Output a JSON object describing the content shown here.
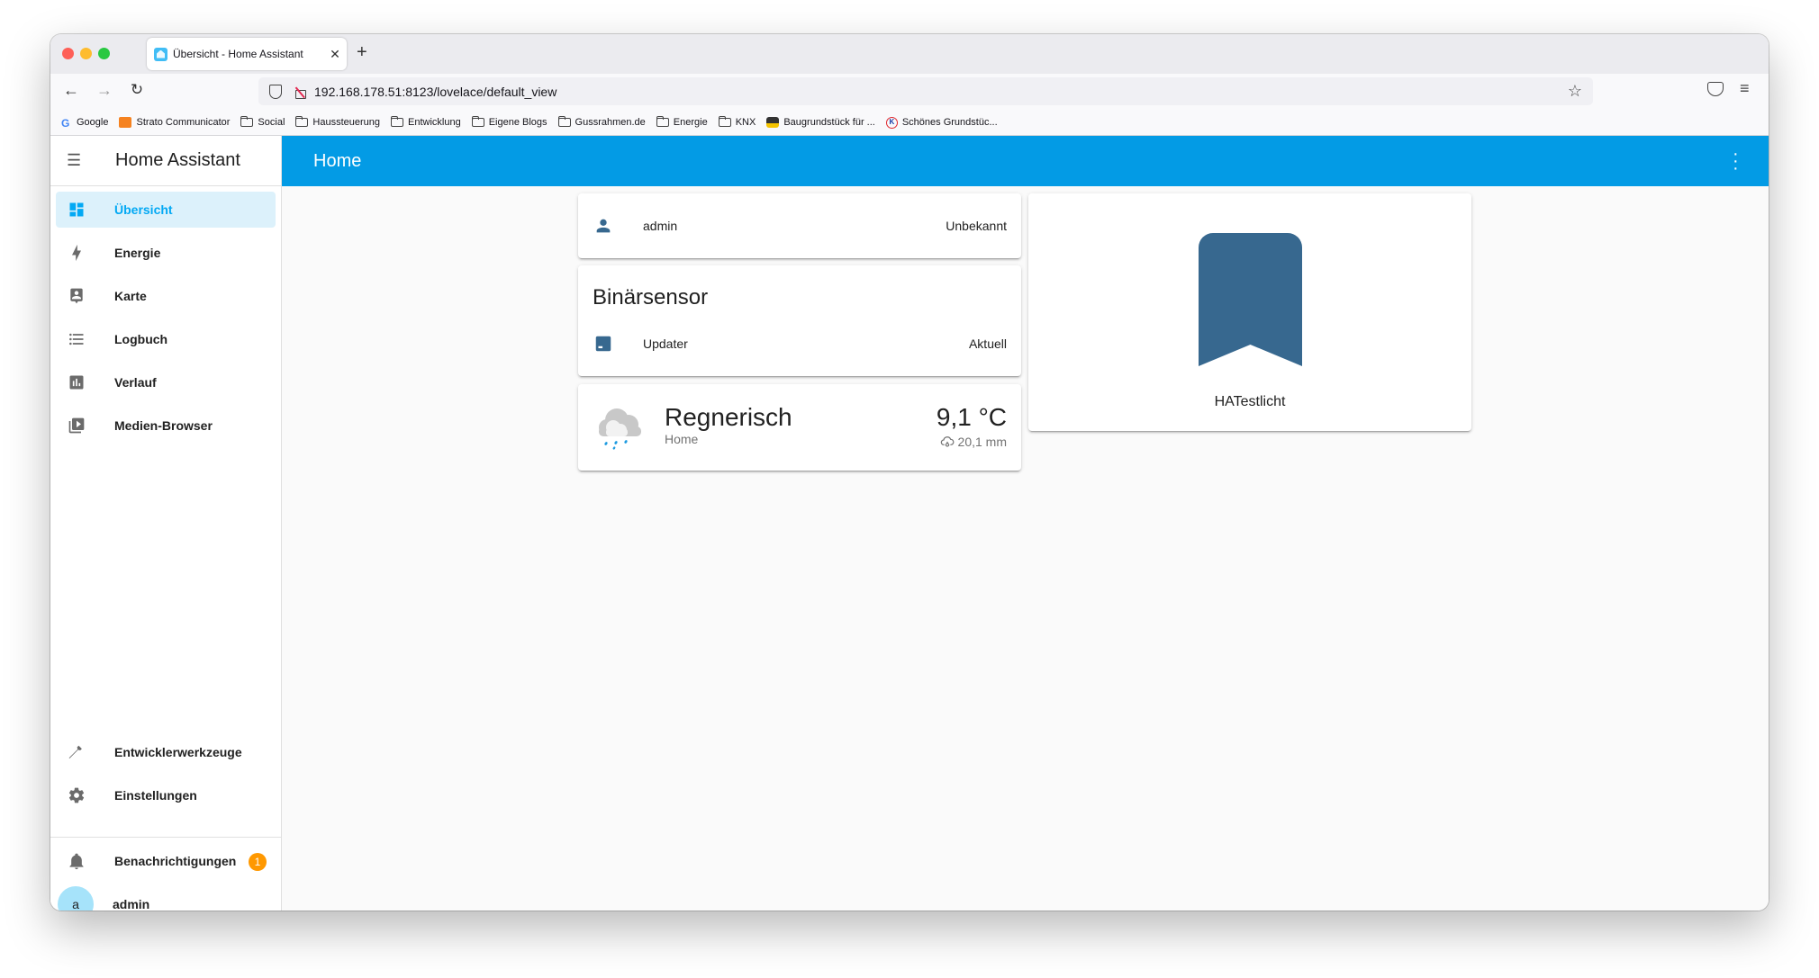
{
  "browser": {
    "tab_title": "Übersicht - Home Assistant",
    "new_tab_label": "+",
    "url": "192.168.178.51:8123/lovelace/default_view",
    "bookmarks": [
      {
        "label": "Google",
        "icon": "google-icon"
      },
      {
        "label": "Strato Communicator",
        "icon": "mail-icon"
      },
      {
        "label": "Social",
        "icon": "folder-icon"
      },
      {
        "label": "Haussteuerung",
        "icon": "folder-icon"
      },
      {
        "label": "Entwicklung",
        "icon": "folder-icon"
      },
      {
        "label": "Eigene Blogs",
        "icon": "folder-icon"
      },
      {
        "label": "Gussrahmen.de",
        "icon": "folder-icon"
      },
      {
        "label": "Energie",
        "icon": "folder-icon"
      },
      {
        "label": "KNX",
        "icon": "folder-icon"
      },
      {
        "label": "Baugrundstück für ...",
        "icon": "immowelt-icon"
      },
      {
        "label": "Schönes Grundstüc...",
        "icon": "k-icon"
      }
    ]
  },
  "sidebar": {
    "title": "Home Assistant",
    "items": [
      {
        "label": "Übersicht",
        "icon": "dashboard-icon",
        "active": true
      },
      {
        "label": "Energie",
        "icon": "lightning-bolt-icon"
      },
      {
        "label": "Karte",
        "icon": "map-person-icon"
      },
      {
        "label": "Logbuch",
        "icon": "list-icon"
      },
      {
        "label": "Verlauf",
        "icon": "chart-box-icon"
      },
      {
        "label": "Medien-Browser",
        "icon": "media-play-icon"
      }
    ],
    "bottom_items": [
      {
        "label": "Entwicklerwerkzeuge",
        "icon": "hammer-icon"
      },
      {
        "label": "Einstellungen",
        "icon": "gear-icon"
      }
    ],
    "notifications": {
      "label": "Benachrichtigungen",
      "count": "1"
    },
    "user": {
      "initial": "a",
      "name": "admin"
    }
  },
  "header": {
    "title": "Home"
  },
  "cards": {
    "person": {
      "name": "admin",
      "state": "Unbekannt"
    },
    "binary_sensor": {
      "title": "Binärsensor",
      "entity": "Updater",
      "state": "Aktuell"
    },
    "weather": {
      "condition": "Regnerisch",
      "location": "Home",
      "temperature": "9,1 °C",
      "precipitation": "20,1 mm"
    },
    "picture": {
      "label": "HATestlicht"
    }
  },
  "colors": {
    "accent": "#03a9f4",
    "header": "#039be5",
    "entity_icon": "#37688f",
    "badge": "#ff9800"
  }
}
